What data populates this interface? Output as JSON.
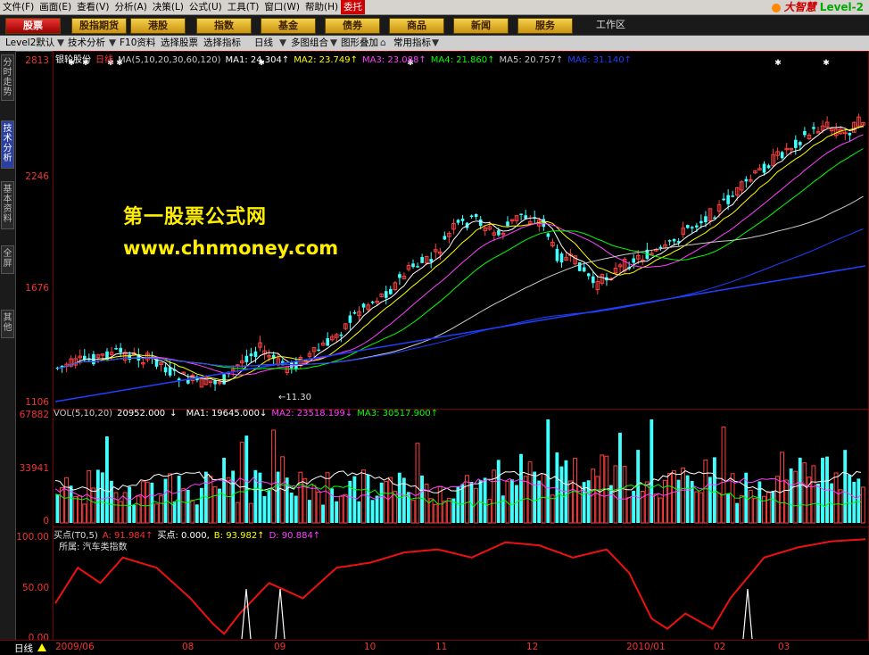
{
  "menu": [
    "文件(F)",
    "画面(E)",
    "查看(V)",
    "分析(A)",
    "决策(L)",
    "公式(U)",
    "工具(T)",
    "窗口(W)",
    "帮助(H)",
    "委托"
  ],
  "brand": {
    "name": "大智慧",
    "level": "Level-2"
  },
  "nav": [
    "股票",
    "股指期货",
    "港股",
    "指数",
    "基金",
    "债券",
    "商品",
    "新闻",
    "服务"
  ],
  "workspace": "工作区",
  "toolbar": [
    "Level2默认",
    "技术分析",
    "F10资料",
    "选择股票",
    "选择指标",
    "日线",
    "多图组合",
    "图形叠加",
    "常用指标"
  ],
  "left_tabs": [
    "分时走势",
    "技术分析",
    "基本资料",
    "全屏",
    "其他"
  ],
  "watermark": {
    "line1": "第一股票公式网",
    "line2": "www.chnmoney.com"
  },
  "price_panel": {
    "stock": "银轮股份",
    "period": "日线",
    "ma_params": "MA(5,10,20,30,60,120)",
    "ma": [
      {
        "label": "MA1:",
        "value": "24.304",
        "arrow": "↑",
        "color": "#ffffff"
      },
      {
        "label": "MA2:",
        "value": "23.749",
        "arrow": "↑",
        "color": "#ffff00"
      },
      {
        "label": "MA3:",
        "value": "23.088",
        "arrow": "↑",
        "color": "#ff40ff"
      },
      {
        "label": "MA4:",
        "value": "21.860",
        "arrow": "↑",
        "color": "#00ff00"
      },
      {
        "label": "MA5:",
        "value": "20.757",
        "arrow": "↑",
        "color": "#cccccc"
      },
      {
        "label": "MA6:",
        "value": "31.140",
        "arrow": "↑",
        "color": "#2040ff"
      }
    ],
    "y_ticks": [
      "2813",
      "2246",
      "1676",
      "1106"
    ],
    "low_note": "←11.30"
  },
  "volume_panel": {
    "params": "VOL(5,10,20)",
    "value": "20952.000",
    "arrow": "↓",
    "ma": [
      {
        "label": "MA1:",
        "value": "19645.000",
        "arrow": "↓",
        "color": "#ffffff"
      },
      {
        "label": "MA2:",
        "value": "23518.199",
        "arrow": "↓",
        "color": "#ff40ff"
      },
      {
        "label": "MA3:",
        "value": "30517.900",
        "arrow": "↑",
        "color": "#00ff00"
      }
    ],
    "y_ticks": [
      "67882",
      "33941",
      "0"
    ]
  },
  "indicator_panel": {
    "name": "买点(T0,5)",
    "values": [
      {
        "label": "A:",
        "value": "91.984",
        "arrow": "↑",
        "color": "#ff3030"
      },
      {
        "label": "买点:",
        "value": "0.000",
        "arrow": ",",
        "color": "#ffffff"
      },
      {
        "label": "B:",
        "value": "93.982",
        "arrow": "↑",
        "color": "#ffff00"
      },
      {
        "label": "D:",
        "value": "90.884",
        "arrow": "↑",
        "color": "#ff40ff"
      }
    ],
    "sector": "所属: 汽车类指数",
    "y_ticks": [
      "100.00",
      "50.00",
      "0.00"
    ]
  },
  "x_axis": {
    "period": "日线",
    "labels": [
      "2009/06",
      "08",
      "09",
      "10",
      "11",
      "12",
      "2010/01",
      "02",
      "03"
    ]
  },
  "colors": {
    "up": "#ff4040",
    "down": "#40ffff",
    "grid": "#7a0000",
    "indicator": "#ee1111"
  }
}
